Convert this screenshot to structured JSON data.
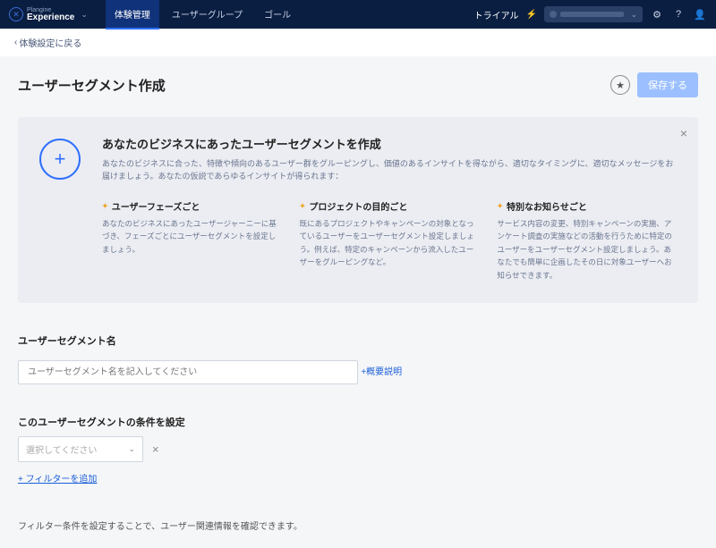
{
  "brand": {
    "sub": "Plangine",
    "main": "Experience"
  },
  "nav": {
    "items": [
      "体験管理",
      "ユーザーグループ",
      "ゴール"
    ],
    "activeIndex": 0
  },
  "topRight": {
    "trial": "トライアル"
  },
  "back": "体験設定に戻る",
  "page": {
    "title": "ユーザーセグメント作成",
    "save": "保存する"
  },
  "banner": {
    "title": "あなたのビジネスにあったユーザーセグメントを作成",
    "desc": "あなたのビジネスに合った、特徴や傾向のあるユーザー群をグルーピングし、価値のあるインサイトを得ながら、適切なタイミングに、適切なメッセージをお届けましょう。あなたの仮説であらゆるインサイトが得られます：",
    "cols": [
      {
        "h": "ユーザーフェーズごと",
        "p": "あなたのビジネスにあったユーザージャーニーに基づき、フェーズごとにユーザーセグメントを設定しましょう。"
      },
      {
        "h": "プロジェクトの目的ごと",
        "p": "既にあるプロジェクトやキャンペーンの対象となっているユーザーをユーザーセグメント設定しましょう。例えば、特定のキャンペーンから流入したユーザーをグルーピングなど。"
      },
      {
        "h": "特別なお知らせごと",
        "p": "サービス内容の変更、特別キャンペーンの実施、アンケート調査の実施などの活動を行うために特定のユーザーをユーザーセグメント設定しましょう。あなたでも簡単に企画したその日に対象ユーザーへお知らせできます。"
      }
    ]
  },
  "form": {
    "nameLabel": "ユーザーセグメント名",
    "namePlaceholder": "ユーザーセグメント名を記入してください",
    "addDesc": "+概要説明",
    "condLabel": "このユーザーセグメントの条件を設定",
    "selectPlaceholder": "選択してください",
    "addFilter": "+ フィルターを追加",
    "footNote": "フィルター条件を設定することで、ユーザー関連情報を確認できます。"
  }
}
